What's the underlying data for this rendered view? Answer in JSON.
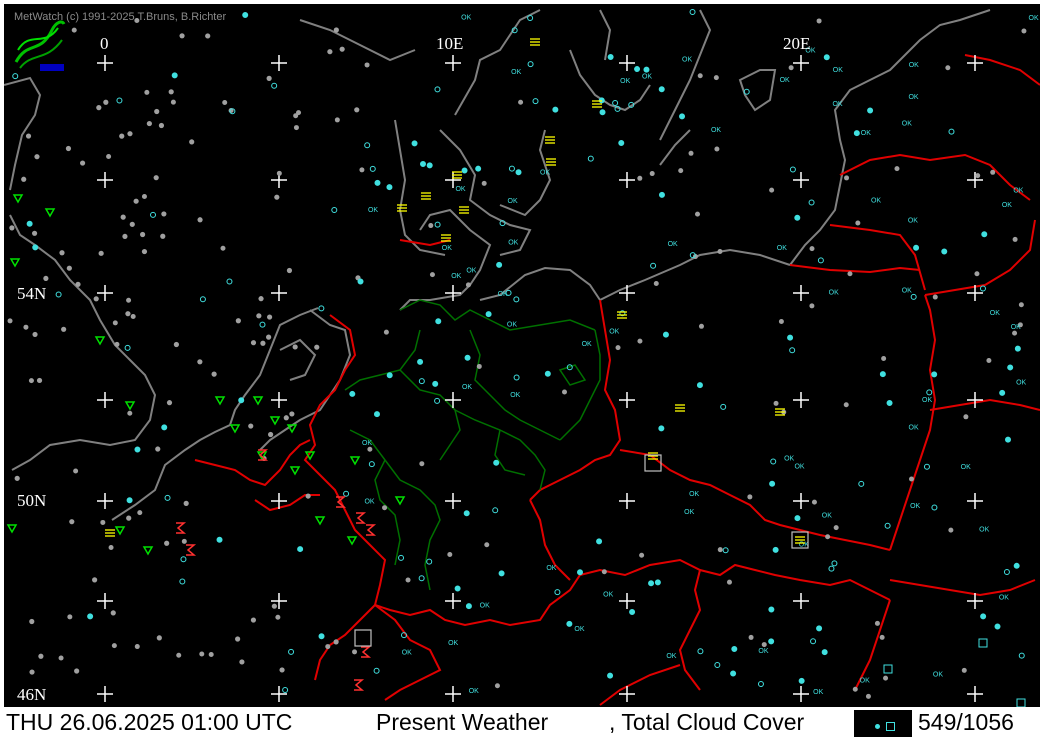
{
  "app": {
    "copyright": "MetWatch  (c) 1991-2025 T.Bruns, B.Richter"
  },
  "map": {
    "longitude_labels": [
      "0",
      "10E",
      "20E"
    ],
    "latitude_labels": [
      "54N",
      "50N",
      "46N"
    ],
    "station_label": "OK",
    "colors": {
      "background": "#000000",
      "coastline": "#808080",
      "border": "#e00000",
      "state_border": "#006400",
      "station": "#40e0e0",
      "weather": "#00e000",
      "fog": "#ffff00",
      "grid": "#ffffff"
    }
  },
  "status_bar": {
    "datetime": "THU 26.06.2025 01:00 UTC",
    "parameter1": "Present Weather",
    "parameter2": ", Total Cloud Cover",
    "count": "549/1056"
  }
}
